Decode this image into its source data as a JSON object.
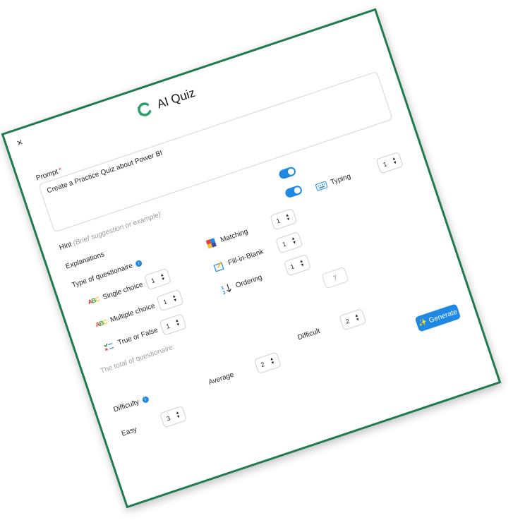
{
  "header": {
    "close_label": "×",
    "title": "AI Quiz"
  },
  "prompt": {
    "label": "Prompt",
    "required_mark": "*",
    "value": "Create a Practice Quiz about Power BI"
  },
  "hint": {
    "label": "Hint",
    "note": "(Brief suggestion or example)",
    "enabled": true
  },
  "explanations": {
    "label": "Explanations",
    "enabled": true
  },
  "questionnaire": {
    "label": "Type of questionaire",
    "types": [
      {
        "label": "Single choice",
        "value": "1",
        "icon": "abc-icon"
      },
      {
        "label": "Multiple choice",
        "value": "1",
        "icon": "abc-icon"
      },
      {
        "label": "True or False",
        "value": "1",
        "icon": "checklist-icon"
      },
      {
        "label": "Matching",
        "value": "1",
        "icon": "puzzle-icon"
      },
      {
        "label": "Fill-in-Blank",
        "value": "1",
        "icon": "edit-box-icon"
      },
      {
        "label": "Ordering",
        "value": "1",
        "icon": "sort-numbers-icon"
      },
      {
        "label": "Typing",
        "value": "1",
        "icon": "keyboard-icon"
      }
    ],
    "total_label": "The total of questionaire:",
    "total_value": "7"
  },
  "difficulty": {
    "label": "Difficulty",
    "levels": [
      {
        "label": "Easy",
        "value": "3"
      },
      {
        "label": "Average",
        "value": "2"
      },
      {
        "label": "Difficult",
        "value": "2"
      }
    ]
  },
  "actions": {
    "generate_label": "Generate"
  },
  "colors": {
    "accent": "#1e88e5",
    "border": "#1f7a4d",
    "required": "#e53935"
  }
}
